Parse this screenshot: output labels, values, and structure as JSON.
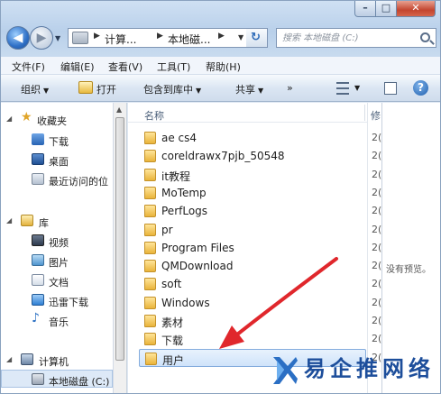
{
  "window": {
    "controls": {
      "minimize": "–",
      "maximize": "□",
      "close": "✕"
    }
  },
  "nav": {
    "back_glyph": "◀",
    "forward_glyph": "▶",
    "breadcrumbs": [
      "计算...",
      "本地磁..."
    ],
    "search_placeholder": "搜索 本地磁盘 (C:)"
  },
  "menubar": [
    "文件(F)",
    "编辑(E)",
    "查看(V)",
    "工具(T)",
    "帮助(H)"
  ],
  "toolbar": {
    "organize": "组织",
    "open": "打开",
    "include_in_library": "包含到库中",
    "share": "共享",
    "more": "»"
  },
  "sidebar": {
    "favorites": {
      "header": "收藏夹",
      "items": [
        "下载",
        "桌面",
        "最近访问的位"
      ]
    },
    "libraries": {
      "header": "库",
      "items": [
        "视频",
        "图片",
        "文档",
        "迅雷下载",
        "音乐"
      ]
    },
    "computer": {
      "header": "计算机",
      "items": [
        "本地磁盘 (C:)"
      ]
    }
  },
  "filelist": {
    "column_name": "名称",
    "column_date_partial": "修",
    "date_partial": "2(",
    "selected_index": 12,
    "folders": [
      "ae cs4",
      "coreldrawx7pjb_50548",
      "it教程",
      "MoTemp",
      "PerfLogs",
      "pr",
      "Program Files",
      "QMDownload",
      "soft",
      "Windows",
      "素材",
      "下载",
      "用户"
    ]
  },
  "preview": {
    "message": "没有预览。"
  },
  "watermark": {
    "brand": "易企推网络"
  }
}
